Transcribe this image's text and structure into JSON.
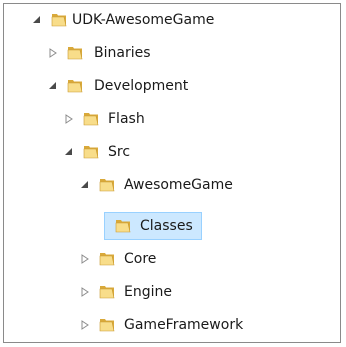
{
  "tree": {
    "nodes": [
      {
        "label": "UDK-AwesomeGame",
        "toggle": "expanded",
        "selected": false
      },
      {
        "label": "Binaries",
        "toggle": "collapsed",
        "selected": false
      },
      {
        "label": "Development",
        "toggle": "expanded",
        "selected": false
      },
      {
        "label": "Flash",
        "toggle": "collapsed",
        "selected": false
      },
      {
        "label": "Src",
        "toggle": "expanded",
        "selected": false
      },
      {
        "label": "AwesomeGame",
        "toggle": "expanded",
        "selected": false
      },
      {
        "label": "Classes",
        "toggle": "none",
        "selected": true
      },
      {
        "label": "Core",
        "toggle": "collapsed",
        "selected": false
      },
      {
        "label": "Engine",
        "toggle": "collapsed",
        "selected": false
      },
      {
        "label": "GameFramework",
        "toggle": "collapsed",
        "selected": false
      }
    ]
  },
  "icons": {
    "folder": "folder-icon",
    "expanded": "expanded-arrow-icon",
    "collapsed": "collapsed-arrow-icon"
  },
  "colors": {
    "selection_fill": "#cce8ff",
    "selection_border": "#99d1ff",
    "folder_light": "#f8dd8a",
    "folder_dark": "#d9a93a"
  }
}
